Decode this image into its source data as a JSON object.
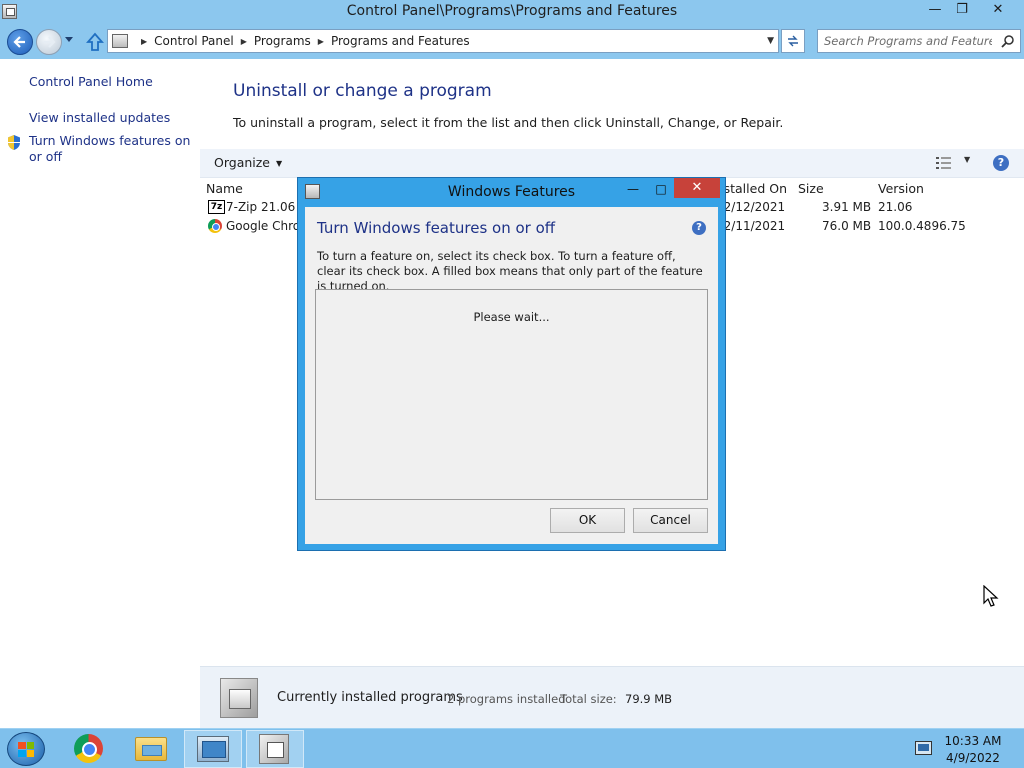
{
  "window": {
    "title": "Control Panel\\Programs\\Programs and Features",
    "minimize_glyph": "—",
    "maximize_glyph": "❐",
    "close_glyph": "✕"
  },
  "address_bar": {
    "breadcrumbs": [
      "Control Panel",
      "Programs",
      "Programs and Features"
    ]
  },
  "search": {
    "placeholder": "Search Programs and Features"
  },
  "sidebar": {
    "links": [
      {
        "label": "Control Panel Home"
      },
      {
        "label": "View installed updates"
      },
      {
        "label": "Turn Windows features on or off",
        "icon": "shield-icon"
      }
    ]
  },
  "main": {
    "heading": "Uninstall or change a program",
    "subtitle": "To uninstall a program, select it from the list and then click Uninstall, Change, or Repair.",
    "toolbar": {
      "organize_label": "Organize"
    },
    "columns": {
      "name": "Name",
      "installed_on": "Installed On",
      "size": "Size",
      "version": "Version"
    },
    "programs": [
      {
        "name": "7-Zip 21.06",
        "installed_on": "12/12/2021",
        "size": "3.91 MB",
        "version": "21.06",
        "icon": "7zip-icon"
      },
      {
        "name": "Google Chrome",
        "installed_on": "12/11/2021",
        "size": "76.0 MB",
        "version": "100.0.4896.75",
        "icon": "chrome-icon"
      }
    ],
    "status": {
      "label": "Currently installed programs",
      "count": "2 programs installed",
      "total_size_label": "Total size:",
      "total_size": "79.9 MB"
    }
  },
  "dialog": {
    "title": "Windows Features",
    "heading": "Turn Windows features on or off",
    "description": "To turn a feature on, select its check box. To turn a feature off, clear its check box. A filled box means that only part of the feature is turned on.",
    "loading_text": "Please wait...",
    "ok_label": "OK",
    "cancel_label": "Cancel"
  },
  "taskbar": {
    "items": [
      "start-button",
      "chrome",
      "file-explorer",
      "control-panel",
      "windows-features"
    ],
    "clock_time": "10:33 AM",
    "clock_date": "4/9/2022"
  },
  "colors": {
    "titlebar": "#8cc7ee",
    "dialog_frame": "#36a2e6",
    "heading_blue": "#1e3287",
    "close_red": "#c7423a",
    "taskbar": "#7fc0ec"
  }
}
